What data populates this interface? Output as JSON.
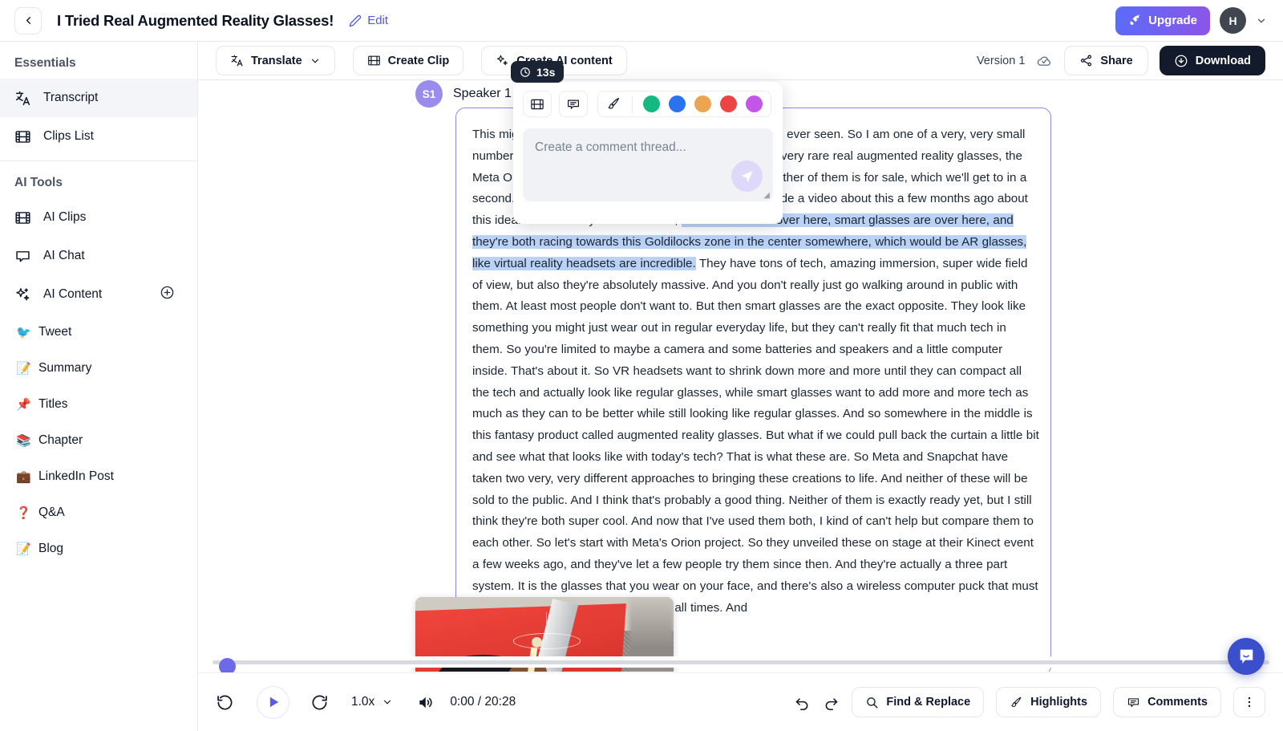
{
  "topbar": {
    "back_icon": "chevron-left-icon",
    "title": "I Tried Real Augmented Reality Glasses!",
    "edit_label": "Edit",
    "edit_icon": "pencil-icon",
    "upgrade_label": "Upgrade",
    "upgrade_icon": "rocket-icon",
    "avatar_initial": "H",
    "chevron": "⌄"
  },
  "sidebar": {
    "essentials_title": "Essentials",
    "essentials": [
      {
        "label": "Transcript",
        "icon": "translate-icon",
        "active": true
      },
      {
        "label": "Clips List",
        "icon": "film-icon",
        "active": false
      }
    ],
    "ai_tools_title": "AI Tools",
    "ai_tools": [
      {
        "label": "AI Clips",
        "icon": "film-icon"
      },
      {
        "label": "AI Chat",
        "icon": "chat-bubble-icon"
      },
      {
        "label": "AI Content",
        "icon": "sparkles-icon",
        "add_icon": "plus-circle-icon"
      }
    ],
    "ai_content_items": [
      {
        "label": "Tweet",
        "emoji": "🐦"
      },
      {
        "label": "Summary",
        "emoji": "📝"
      },
      {
        "label": "Titles",
        "emoji": "📌"
      },
      {
        "label": "Chapter",
        "emoji": "📚"
      },
      {
        "label": "LinkedIn Post",
        "emoji": "💼"
      },
      {
        "label": "Q&A",
        "emoji": "❓"
      },
      {
        "label": "Blog",
        "emoji": "📝"
      }
    ]
  },
  "editor_toolbar": {
    "translate_label": "Translate",
    "translate_icon": "translate-icon",
    "create_clip_label": "Create Clip",
    "create_clip_icon": "film-icon",
    "create_ai_content_label": "Create AI content",
    "create_ai_content_icon": "sparkles-icon",
    "version_label": "Version 1",
    "saved_icon": "cloud-check-icon",
    "share_label": "Share",
    "share_icon": "share-icon",
    "download_label": "Download",
    "download_icon": "cloud-download-icon"
  },
  "transcript": {
    "speaker_initial": "S1",
    "speaker_name": "Speaker 1",
    "part1": "This might be the best look into the future of tech that I've ever seen. So I am one of a very, very small number of people who's used both of the brand new and very rare real augmented reality glasses, the Meta Orion glasses and the Snapchat AR spectacles. Neither of them is for sale, which we'll get to in a second. But also they're both pretty incredible. Now, I made a video about this a few months ago about this idea. But in case you missed that, ",
    "highlight": "VR headsets are over here, smart glasses are over here, and they're both racing towards this Goldilocks zone in the center somewhere, which would be AR glasses, like virtual reality headsets are incredible.",
    "part2": " They have tons of tech, amazing immersion, super wide field of view, but also they're absolutely massive. And you don't really just go walking around in public with them. At least most people don't want to. But then smart glasses are the exact opposite. They look like something you might just wear out in regular everyday life, but they can't really fit that much tech in them. So you're limited to maybe a camera and some batteries and speakers and a little computer inside. That's about it. So VR headsets want to shrink down more and more until they can compact all the tech and actually look like regular glasses, while smart glasses want to add more and more tech as much as they can to be better while still looking like regular glasses. And so somewhere in the middle is this fantasy product called augmented reality glasses. But what if we could pull back the curtain a little bit and see what that looks like with today's tech? That is what these are. So Meta and Snapchat have taken two very, very different approaches to bringing these creations to life. And neither of these will be sold to the public. And I think that's probably a good thing. Neither of them is exactly ready yet, but I still think they're both super cool. And now that I've used them both, I kind of can't help but compare them to each other. So let's start with Meta's Orion project. So they unveiled these on stage at their Kinect event a few weeks ago, and they've let a few people try them since then. And they're actually a three part system. It is the glasses that you wear on your face, and there's also a wireless computer puck that must be within about 15ft of the glasses at all times. And"
  },
  "comment_popover": {
    "time_badge": "13s",
    "clock_icon": "clock-icon",
    "clip_icon": "film-icon",
    "comment_icon": "comment-icon",
    "brush_icon": "brush-icon",
    "placeholder": "Create a comment thread...",
    "send_icon": "send-icon",
    "swatches": [
      "#15b881",
      "#2a72ee",
      "#eba452",
      "#ea4444",
      "#c355e8"
    ]
  },
  "player": {
    "rewind_icon": "rewind-10-icon",
    "play_icon": "play-icon",
    "forward_icon": "forward-10-icon",
    "speed_label": "1.0x",
    "volume_icon": "volume-icon",
    "current_time": "0:00",
    "total_time": "20:28",
    "time_display": "0:00 / 20:28",
    "undo_icon": "undo-icon",
    "redo_icon": "redo-icon",
    "find_replace_label": "Find & Replace",
    "find_replace_icon": "search-icon",
    "highlights_label": "Highlights",
    "highlights_icon": "brush-icon",
    "comments_label": "Comments",
    "comments_icon": "comment-icon",
    "kebab_icon": "more-vertical-icon"
  },
  "chat_fab": {
    "icon": "intercom-chat-icon"
  },
  "colors": {
    "accent_purple": "#6d6ae8",
    "link_blue": "#4f56f5",
    "highlight_blue": "#b9d2f5",
    "dark_button": "#121a2b",
    "fab_blue": "#3b4ecb"
  }
}
